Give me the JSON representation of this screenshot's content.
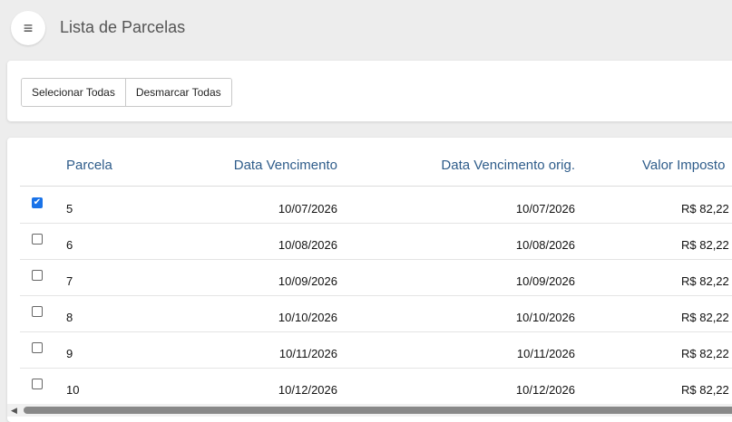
{
  "header": {
    "menu_icon": "hamburger-icon",
    "title": "Lista de Parcelas"
  },
  "toolbar": {
    "select_all_label": "Selecionar Todas",
    "deselect_all_label": "Desmarcar Todas"
  },
  "table": {
    "columns": [
      "Parcela",
      "Data Vencimento",
      "Data Vencimento orig.",
      "Valor Imposto"
    ],
    "rows": [
      {
        "checked": true,
        "parcela": "5",
        "vencimento": "10/07/2026",
        "vencimento_orig": "10/07/2026",
        "valor": "R$ 82,22"
      },
      {
        "checked": false,
        "parcela": "6",
        "vencimento": "10/08/2026",
        "vencimento_orig": "10/08/2026",
        "valor": "R$ 82,22"
      },
      {
        "checked": false,
        "parcela": "7",
        "vencimento": "10/09/2026",
        "vencimento_orig": "10/09/2026",
        "valor": "R$ 82,22"
      },
      {
        "checked": false,
        "parcela": "8",
        "vencimento": "10/10/2026",
        "vencimento_orig": "10/10/2026",
        "valor": "R$ 82,22"
      },
      {
        "checked": false,
        "parcela": "9",
        "vencimento": "10/11/2026",
        "vencimento_orig": "10/11/2026",
        "valor": "R$ 82,22"
      },
      {
        "checked": false,
        "parcela": "10",
        "vencimento": "10/12/2026",
        "vencimento_orig": "10/12/2026",
        "valor": "R$ 82,22"
      }
    ]
  },
  "colors": {
    "header_text": "#2e5c8a",
    "checkbox_checked": "#1a73e8"
  }
}
